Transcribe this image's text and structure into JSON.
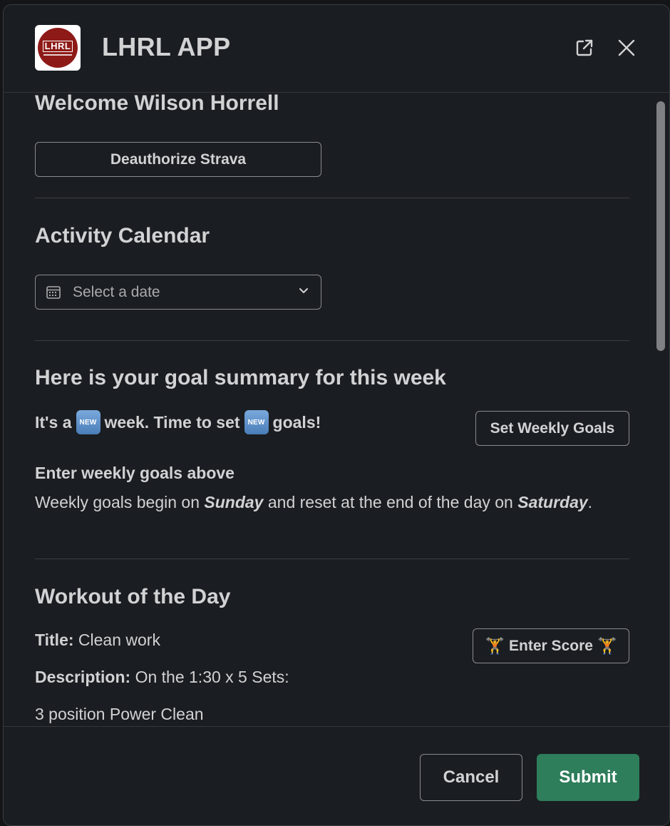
{
  "app": {
    "title": "LHRL APP",
    "logo_text": "LHRL",
    "open_icon": "external-link-icon",
    "close_icon": "close-icon"
  },
  "welcome": {
    "heading": "Welcome Wilson Horrell",
    "deauth_label": "Deauthorize Strava"
  },
  "calendar": {
    "heading": "Activity Calendar",
    "placeholder": "Select a date",
    "icon": "calendar-icon",
    "chevron": "chevron-down-icon"
  },
  "goals": {
    "heading": "Here is your goal summary for this week",
    "line_part1": "It's a",
    "line_part2": "week. Time to set",
    "line_part3": "goals!",
    "new_badge": "NEW",
    "set_goals_label": "Set Weekly Goals",
    "enter_heading": "Enter weekly goals above",
    "text_part1": "Weekly goals begin on ",
    "text_sunday": "Sunday",
    "text_part2": " and reset at the end of the day on ",
    "text_saturday": "Saturday",
    "text_part3": "."
  },
  "wod": {
    "heading": "Workout of the Day",
    "title_label": "Title:",
    "title_value": " Clean work",
    "desc_label": "Description:",
    "desc_value": " On the 1:30 x 5 Sets:",
    "line3": "3 position Power Clean",
    "score_label": "Enter Score",
    "lifter_emoji": "🏋"
  },
  "footer": {
    "cancel_label": "Cancel",
    "submit_label": "Submit"
  },
  "colors": {
    "background": "#1a1d21",
    "text": "#d1d2d3",
    "submit": "#2e7d5b",
    "logo_red": "#8e1a17",
    "new_badge": "#5b8fc7"
  }
}
